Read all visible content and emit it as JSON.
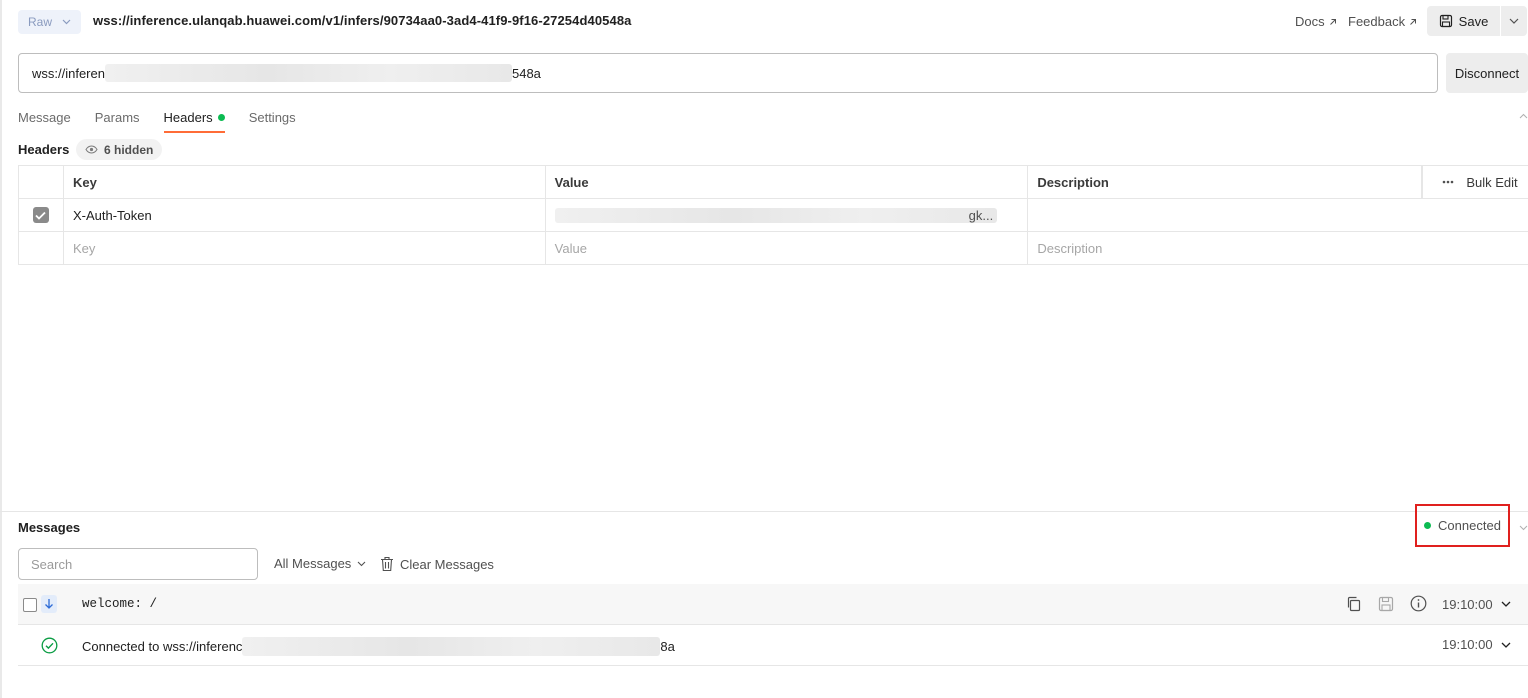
{
  "request": {
    "mode_label": "Raw",
    "title": "wss://inference.ulanqab.huawei.com/v1/infers/90734aa0-3ad4-41f9-9f16-27254d40548a",
    "url_prefix": "wss://inferen",
    "url_suffix": "548a"
  },
  "top_links": {
    "docs": "Docs",
    "feedback": "Feedback",
    "save": "Save"
  },
  "connection": {
    "disconnect_label": "Disconnect",
    "status": "Connected",
    "status_color": "#0cbb52"
  },
  "tabs": [
    {
      "label": "Message",
      "active": false
    },
    {
      "label": "Params",
      "active": false
    },
    {
      "label": "Headers",
      "active": true,
      "indicator": true
    },
    {
      "label": "Settings",
      "active": false
    }
  ],
  "headers_section": {
    "title": "Headers",
    "hidden_count_label": "6 hidden",
    "columns": {
      "key": "Key",
      "value": "Value",
      "description": "Description",
      "bulk_edit": "Bulk Edit"
    },
    "rows": [
      {
        "checked": true,
        "key": "X-Auth-Token",
        "value_suffix": "gk...",
        "description": ""
      }
    ],
    "placeholder": {
      "key": "Key",
      "value": "Value",
      "description": "Description"
    }
  },
  "messages": {
    "title": "Messages",
    "search_placeholder": "Search",
    "filter_label": "All Messages",
    "clear_label": "Clear Messages",
    "items": [
      {
        "direction": "incoming",
        "text": "welcome: /",
        "time": "19:10:00"
      },
      {
        "type": "connected",
        "text_prefix": "Connected to wss://inferenc",
        "text_suffix": "8a",
        "time": "19:10:00"
      }
    ]
  },
  "accent_color": "#ff6c37",
  "highlight_box_color": "#e0201e"
}
